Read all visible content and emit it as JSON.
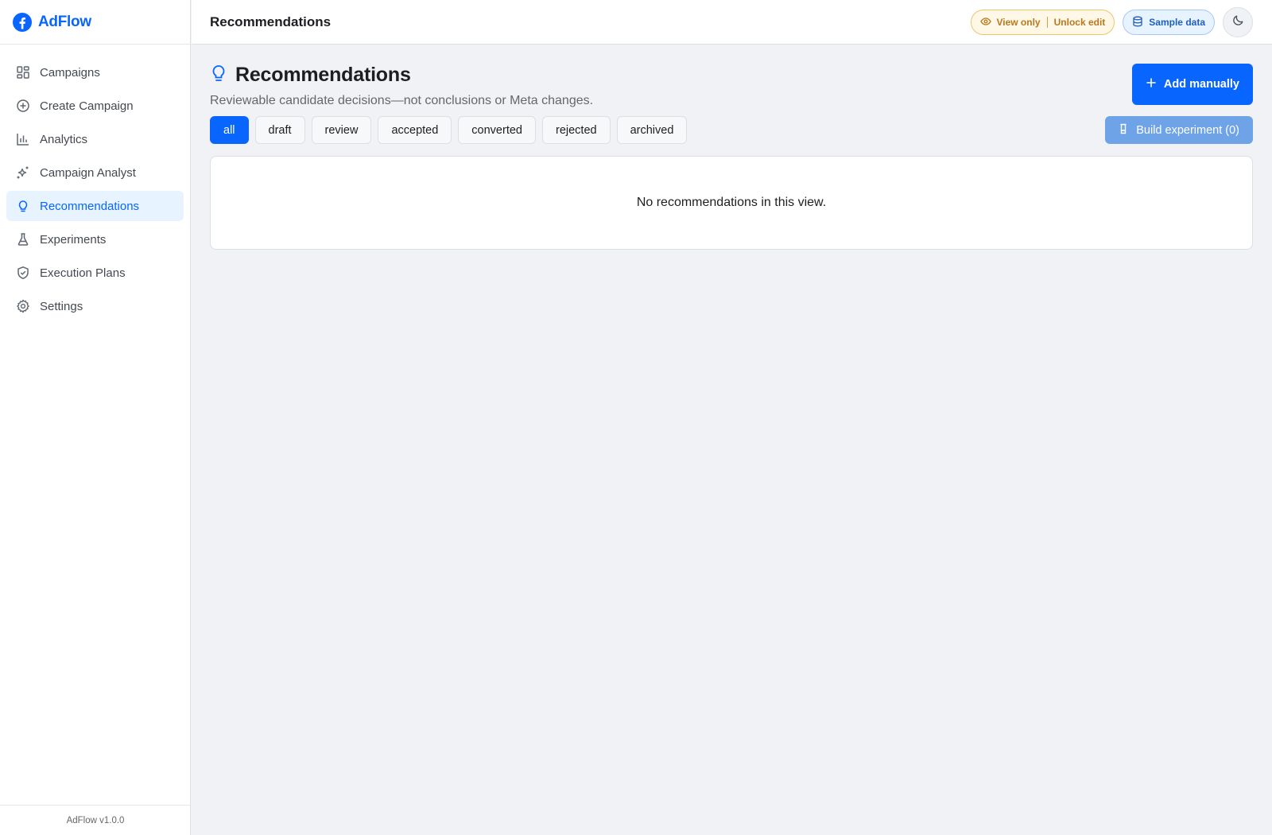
{
  "brand": {
    "name": "AdFlow",
    "logo_icon": "facebook-logo-icon",
    "accent": "#0866ff"
  },
  "sidebar": {
    "items": [
      {
        "label": "Campaigns",
        "icon": "grid-icon",
        "active": false
      },
      {
        "label": "Create Campaign",
        "icon": "plus-circle-icon",
        "active": false
      },
      {
        "label": "Analytics",
        "icon": "bar-chart-icon",
        "active": false
      },
      {
        "label": "Campaign Analyst",
        "icon": "sparkles-icon",
        "active": false
      },
      {
        "label": "Recommendations",
        "icon": "lightbulb-icon",
        "active": true
      },
      {
        "label": "Experiments",
        "icon": "flask-icon",
        "active": false
      },
      {
        "label": "Execution Plans",
        "icon": "shield-check-icon",
        "active": false
      },
      {
        "label": "Settings",
        "icon": "gear-icon",
        "active": false
      }
    ],
    "version": "AdFlow v1.0.0"
  },
  "topbar": {
    "title": "Recommendations",
    "view_only_label": "View only",
    "unlock_label": "Unlock edit",
    "sample_data_label": "Sample data",
    "theme_icon": "moon-icon"
  },
  "page": {
    "title": "Recommendations",
    "subtitle": "Reviewable candidate decisions—not conclusions or Meta changes.",
    "add_button_label": "Add manually",
    "build_button_label": "Build experiment (0)",
    "tabs": [
      {
        "label": "all",
        "active": true
      },
      {
        "label": "draft",
        "active": false
      },
      {
        "label": "review",
        "active": false
      },
      {
        "label": "accepted",
        "active": false
      },
      {
        "label": "converted",
        "active": false
      },
      {
        "label": "rejected",
        "active": false
      },
      {
        "label": "archived",
        "active": false
      }
    ],
    "empty_message": "No recommendations in this view."
  }
}
